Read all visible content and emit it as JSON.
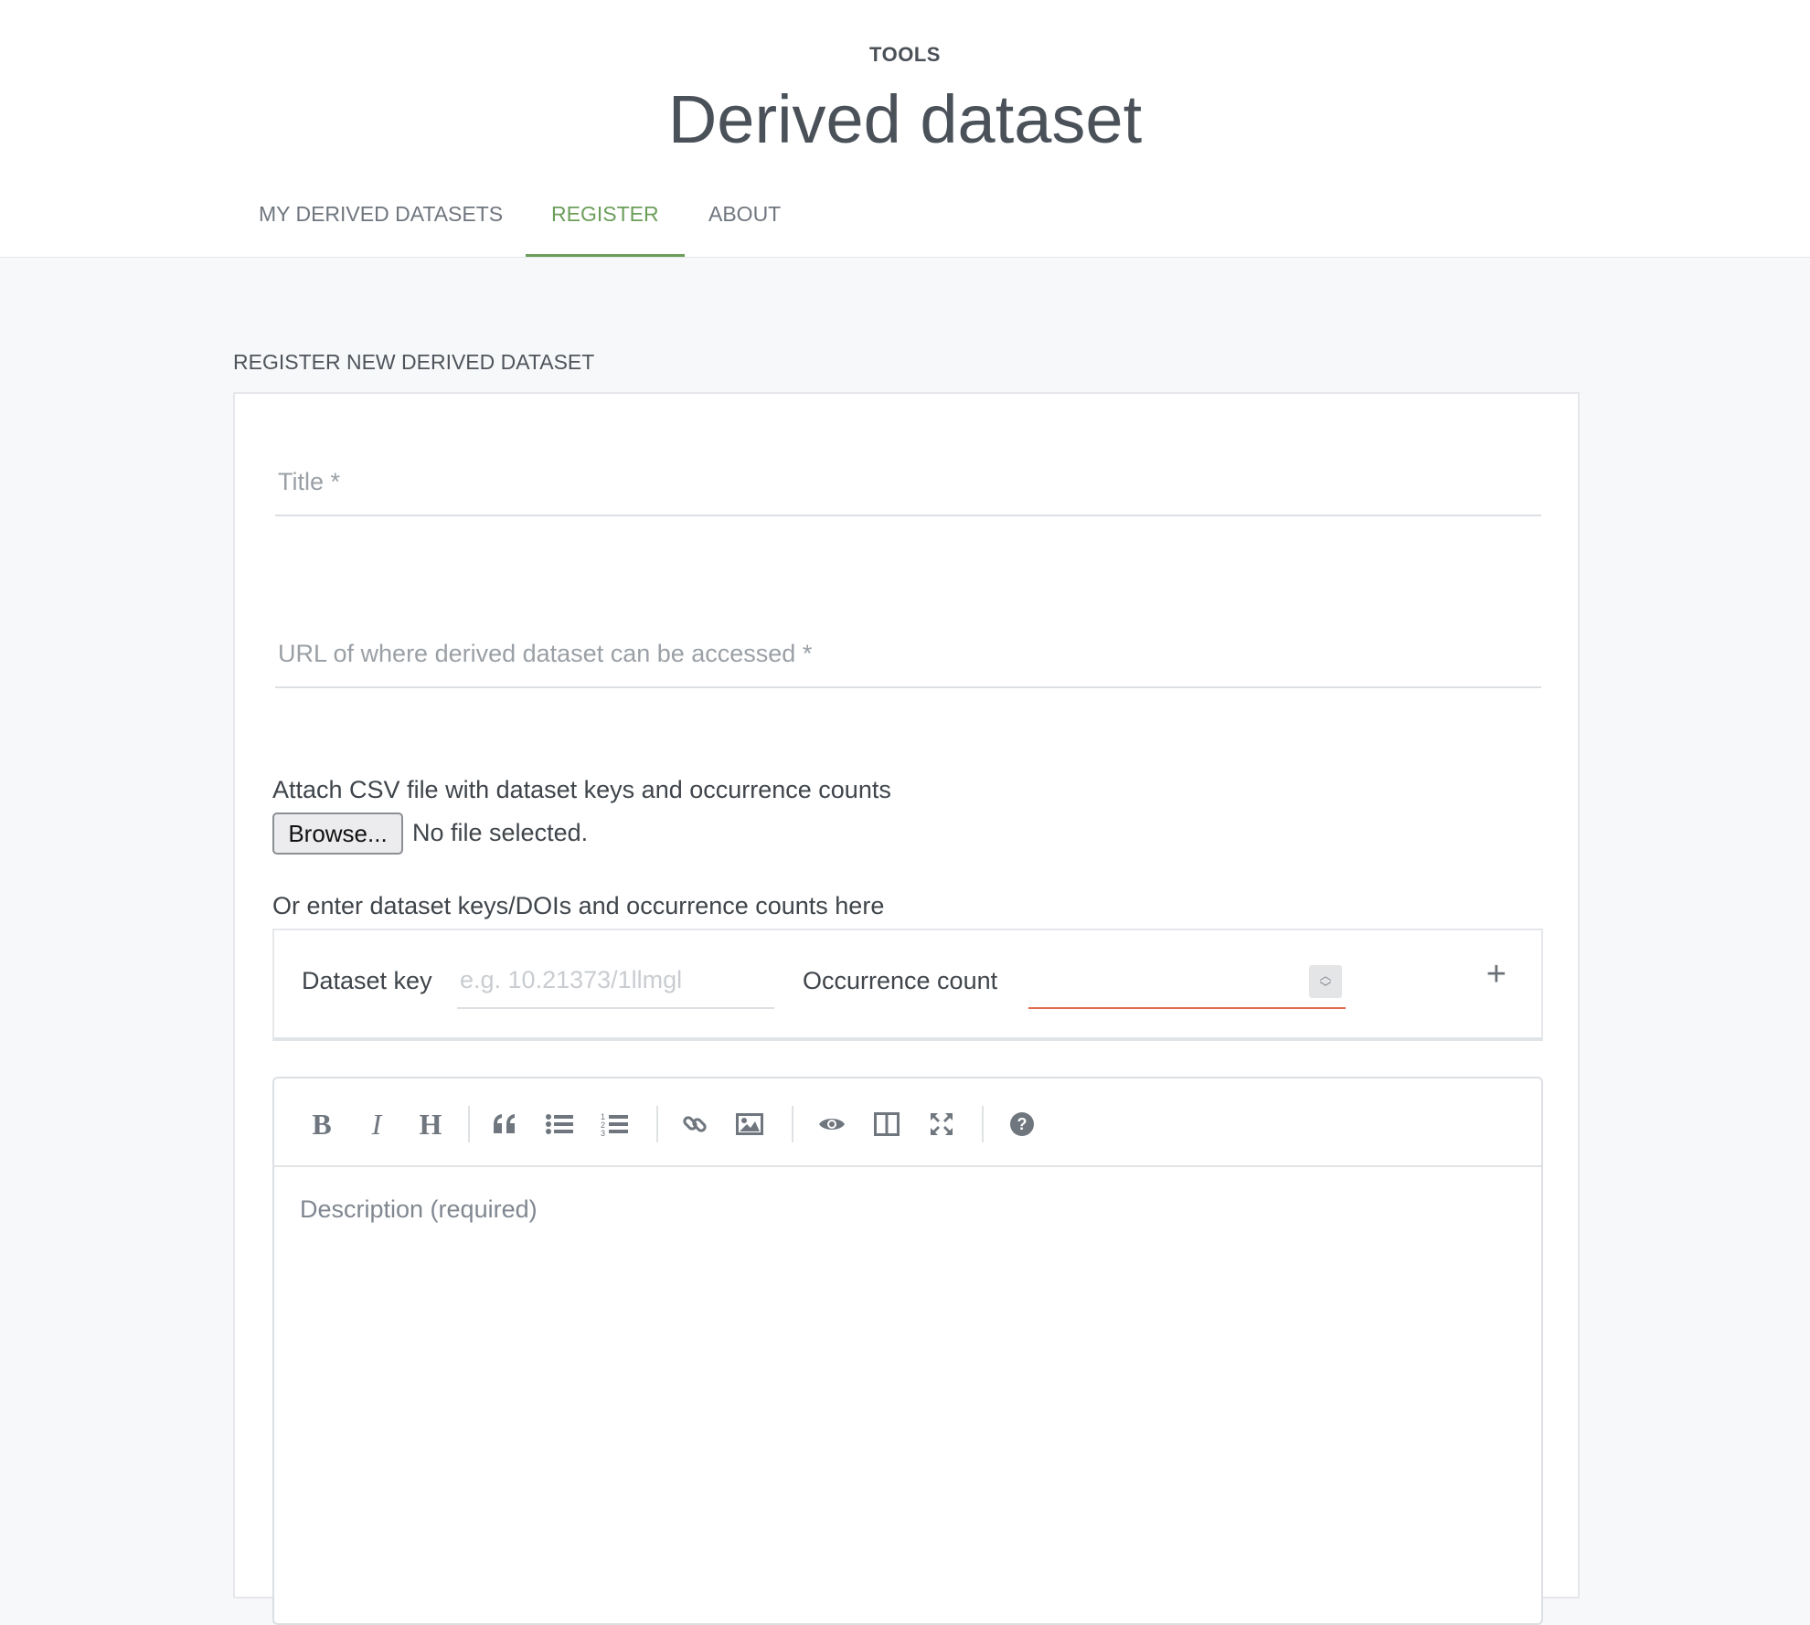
{
  "header": {
    "kicker": "TOOLS",
    "title": "Derived dataset",
    "tabs": [
      {
        "label": "MY DERIVED DATASETS",
        "active": false
      },
      {
        "label": "REGISTER",
        "active": true
      },
      {
        "label": "ABOUT",
        "active": false
      }
    ]
  },
  "form": {
    "section_label": "REGISTER NEW DERIVED DATASET",
    "title_field": {
      "placeholder": "Title *",
      "value": ""
    },
    "url_field": {
      "placeholder": "URL of where derived dataset can be accessed *",
      "value": ""
    },
    "attach": {
      "label": "Attach CSV file with dataset keys and occurrence counts",
      "browse_label": "Browse...",
      "file_status": "No file selected."
    },
    "manual": {
      "label": "Or enter dataset keys/DOIs and occurrence counts here",
      "dataset_key_label": "Dataset key",
      "dataset_key_placeholder": "e.g. 10.21373/1llmgl",
      "occurrence_count_label": "Occurrence count",
      "occurrence_count_value": "",
      "add_icon": "plus-icon"
    },
    "editor": {
      "toolbar": [
        "bold-icon",
        "italic-icon",
        "heading-icon",
        "quote-icon",
        "unordered-list-icon",
        "ordered-list-icon",
        "link-icon",
        "image-icon",
        "preview-icon",
        "side-by-side-icon",
        "fullscreen-icon",
        "help-icon"
      ],
      "placeholder": "Description (required)"
    }
  },
  "colors": {
    "accent_green": "#6c9e5a",
    "error_red": "#e06b4e",
    "page_bg": "#f7f8f9"
  }
}
